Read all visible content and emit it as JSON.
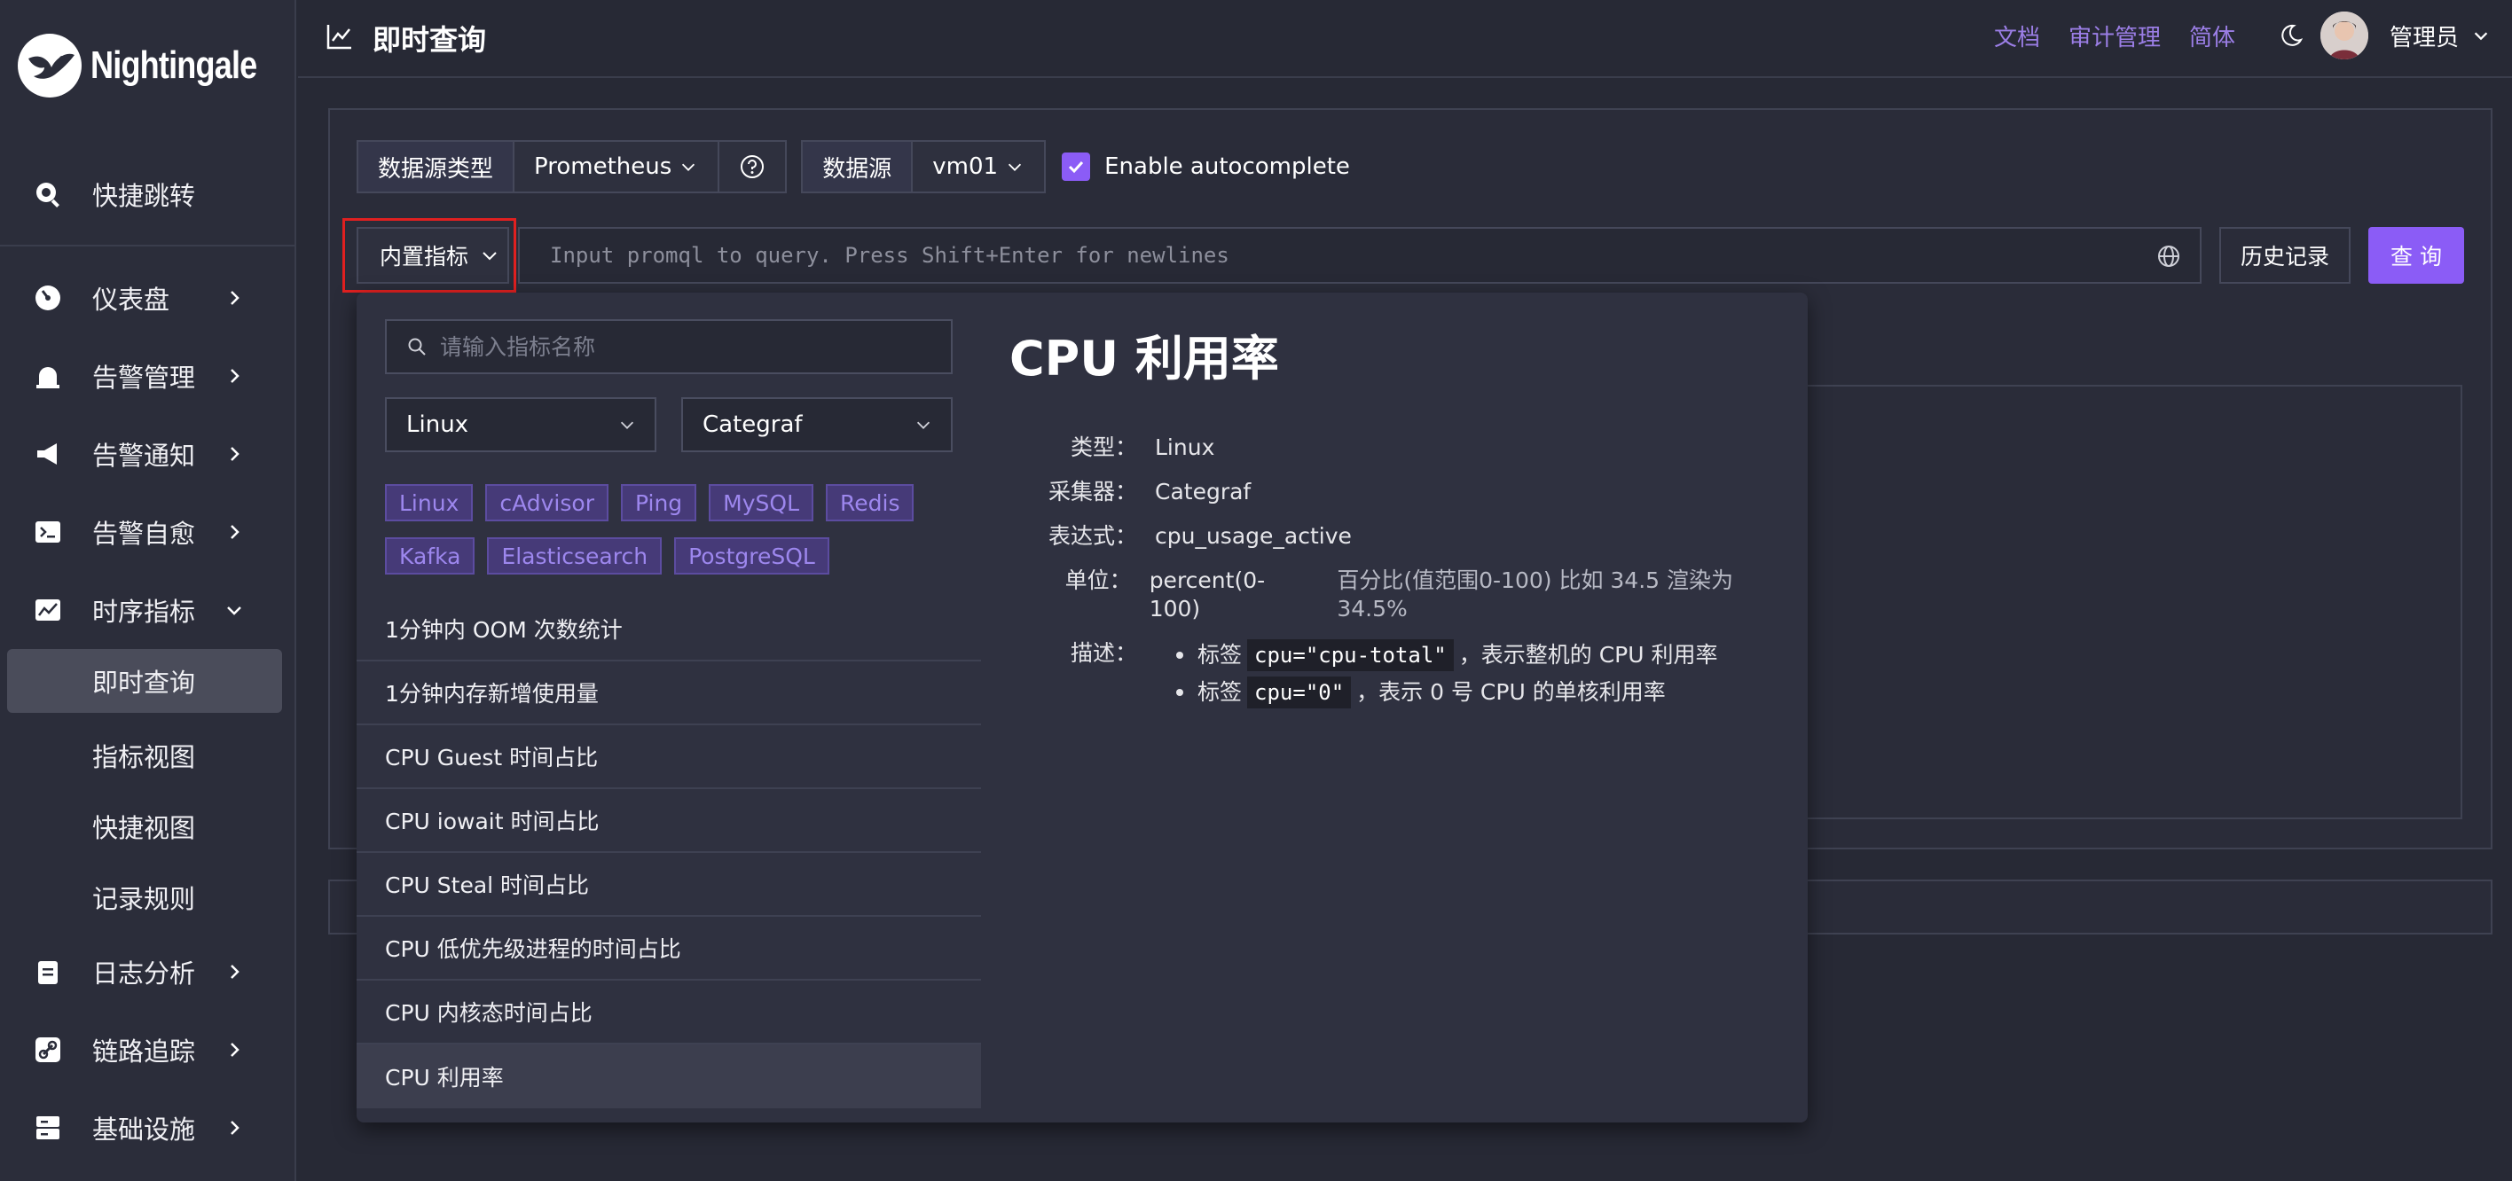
{
  "brand": {
    "name": "Nightingale"
  },
  "sidebar": {
    "quick_jump": "快捷跳转",
    "items": [
      {
        "label": "仪表盘",
        "icon": "dashboard-icon"
      },
      {
        "label": "告警管理",
        "icon": "alarm-bell-icon"
      },
      {
        "label": "告警通知",
        "icon": "megaphone-icon"
      },
      {
        "label": "告警自愈",
        "icon": "terminal-icon"
      },
      {
        "label": "时序指标",
        "icon": "line-chart-icon"
      }
    ],
    "sub_items": [
      "即时查询",
      "指标视图",
      "快捷视图",
      "记录规则"
    ],
    "items2": [
      {
        "label": "日志分析",
        "icon": "clipboard-icon"
      },
      {
        "label": "链路追踪",
        "icon": "link-icon"
      },
      {
        "label": "基础设施",
        "icon": "server-icon"
      }
    ]
  },
  "header": {
    "title": "即时查询",
    "links": [
      "文档",
      "审计管理",
      "简体"
    ],
    "user": "管理员"
  },
  "query": {
    "datasource_type_label": "数据源类型",
    "datasource_type_value": "Prometheus",
    "datasource_label": "数据源",
    "datasource_value": "vm01",
    "autocomplete_label": "Enable autocomplete",
    "builtin_metrics_label": "内置指标",
    "promql_placeholder": "Input promql to query. Press Shift+Enter for newlines",
    "history_label": "历史记录",
    "query_label": "查 询"
  },
  "dropdown": {
    "search_placeholder": "请输入指标名称",
    "type_select": "Linux",
    "collector_select": "Categraf",
    "tags": [
      "Linux",
      "cAdvisor",
      "Ping",
      "MySQL",
      "Redis",
      "Kafka",
      "Elasticsearch",
      "PostgreSQL"
    ],
    "metrics": [
      "1分钟内 OOM 次数统计",
      "1分钟内存新增使用量",
      "CPU Guest 时间占比",
      "CPU iowait 时间占比",
      "CPU Steal 时间占比",
      "CPU 低优先级进程的时间占比",
      "CPU 内核态时间占比",
      "CPU 利用率"
    ],
    "detail": {
      "title": "CPU 利用率",
      "type_key": "类型：",
      "type_value": "Linux",
      "collector_key": "采集器：",
      "collector_value": "Categraf",
      "expr_key": "表达式：",
      "expr_value": "cpu_usage_active",
      "unit_key": "单位：",
      "unit_value": "percent(0-100)",
      "unit_note": "百分比(值范围0-100) 比如 34.5 渲染为 34.5%",
      "desc_key": "描述：",
      "desc1_pre": "标签",
      "desc1_code": "cpu=\"cpu-total\"",
      "desc1_post": "，表示整机的 CPU 利用率",
      "desc2_pre": "标签",
      "desc2_code": "cpu=\"0\"",
      "desc2_post": "，表示 0 号 CPU 的单核利用率"
    }
  },
  "colors": {
    "accent": "#8b5cf6",
    "link": "#9b7ee6",
    "highlight_frame": "#e02020"
  }
}
